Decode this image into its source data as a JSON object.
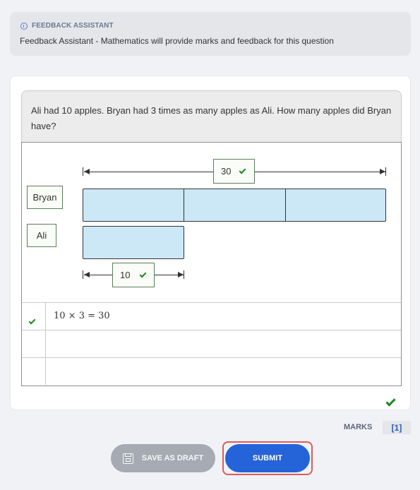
{
  "feedback_assistant": {
    "header": "FEEDBACK ASSISTANT",
    "icon": "info-icon",
    "description": "Feedback Assistant - Mathematics will provide marks and feedback for this question"
  },
  "question": {
    "text": "Ali had 10 apples. Bryan had 3 times as many apples as Ali. How many apples did Bryan have?"
  },
  "bar_model": {
    "labels": {
      "bryan": "Bryan",
      "ali": "Ali"
    },
    "bryan_total": "30",
    "ali_value": "10",
    "bar_color": "#cce8f6",
    "correct_color": "#178a17"
  },
  "working": {
    "rows": [
      {
        "text": "10 × 3 = 30",
        "status": "correct"
      },
      {
        "text": "",
        "status": ""
      },
      {
        "text": "",
        "status": ""
      }
    ]
  },
  "marks": {
    "label": "MARKS",
    "value": "[1]"
  },
  "actions": {
    "save_draft": "SAVE AS DRAFT",
    "submit": "SUBMIT",
    "submit_color": "#2563d9"
  }
}
